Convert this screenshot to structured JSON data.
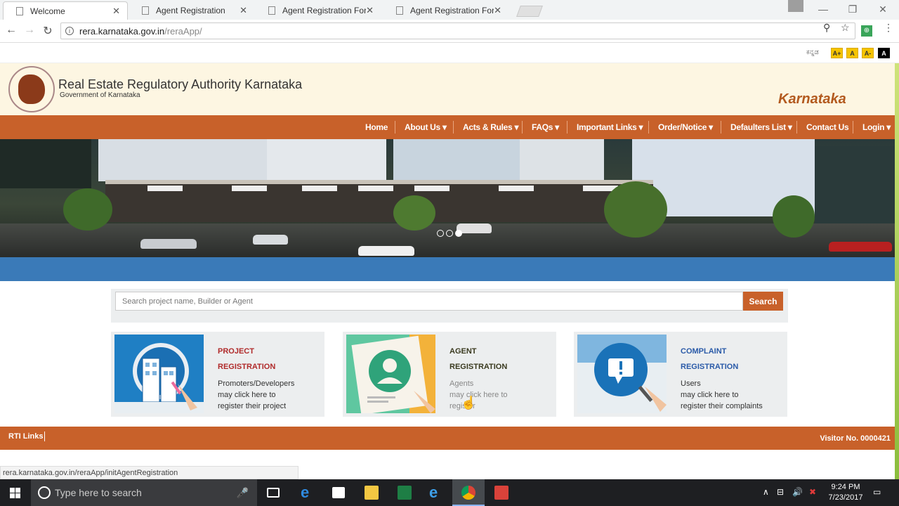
{
  "browser": {
    "tabs": [
      {
        "title": "Welcome",
        "active": true
      },
      {
        "title": "Agent Registration",
        "active": false
      },
      {
        "title": "Agent Registration Form",
        "active": false
      },
      {
        "title": "Agent Registration Form",
        "active": false
      }
    ],
    "url_host": "rera.karnataka.gov.in",
    "url_path": "/reraApp/",
    "status_url": "rera.karnataka.gov.in/reraApp/initAgentRegistration"
  },
  "topstrip": {
    "lang_label": "ಕನ್ನಡ",
    "font_buttons": [
      "A+",
      "A",
      "A-",
      "A"
    ]
  },
  "header": {
    "title": "Real Estate Regulatory Authority Karnataka",
    "subtitle": "Government of Karnataka",
    "state": "Karnataka"
  },
  "nav": {
    "items": [
      {
        "label": "Home"
      },
      {
        "label": "About Us ▾"
      },
      {
        "label": "Acts & Rules ▾"
      },
      {
        "label": "FAQs ▾"
      },
      {
        "label": "Important Links ▾"
      },
      {
        "label": "Order/Notice ▾"
      },
      {
        "label": "Defaulters List ▾"
      },
      {
        "label": "Contact Us"
      },
      {
        "label": "Login ▾"
      }
    ]
  },
  "search": {
    "placeholder": "Search project name, Builder or Agent",
    "button": "Search"
  },
  "cards": [
    {
      "title1": "PROJECT",
      "title2": "REGISTRATION",
      "desc": [
        "Promoters/Developers",
        "may click here to",
        "register their project"
      ],
      "color": "#b02a2a"
    },
    {
      "title1": "AGENT",
      "title2": "REGISTRATION",
      "desc": [
        "Agents",
        "may click here to",
        "register"
      ],
      "color": "#3a3a1f"
    },
    {
      "title1": "COMPLAINT",
      "title2": "REGISTRATION",
      "desc": [
        "Users",
        "may click here to",
        "register their complaints"
      ],
      "color": "#2a5aa8"
    }
  ],
  "footer": {
    "rti": "RTI Links",
    "visitor": "Visitor No. 0000421"
  },
  "taskbar": {
    "search_placeholder": "Type here to search",
    "time": "9:24 PM",
    "date": "7/23/2017"
  }
}
